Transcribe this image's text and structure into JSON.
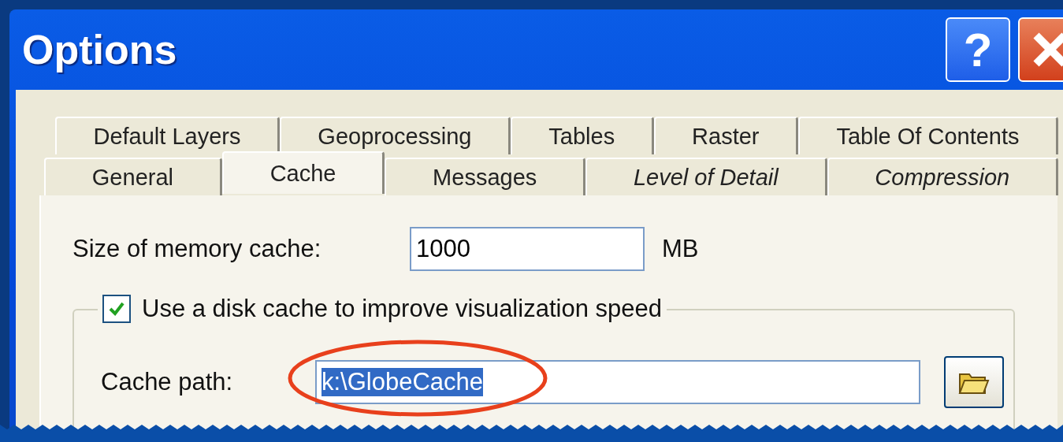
{
  "window": {
    "title": "Options",
    "buttons": [
      {
        "kind": "help",
        "label": "?"
      },
      {
        "kind": "close"
      }
    ]
  },
  "tab_rows": [
    {
      "tabs": [
        {
          "label": "Default Layers",
          "kind": "normal",
          "selected": false
        },
        {
          "label": "Geoprocessing",
          "kind": "normal",
          "selected": false
        },
        {
          "label": "Tables",
          "kind": "normal",
          "selected": false
        },
        {
          "label": "Raster",
          "kind": "normal",
          "selected": false
        },
        {
          "label": "Table Of Contents",
          "kind": "normal",
          "selected": false
        }
      ]
    },
    {
      "tabs": [
        {
          "label": "General",
          "kind": "normal",
          "selected": false
        },
        {
          "label": "Cache",
          "kind": "normal",
          "selected": true
        },
        {
          "label": "Messages",
          "kind": "normal",
          "selected": false
        },
        {
          "label": "Level of Detail",
          "kind": "italic",
          "selected": false
        },
        {
          "label": "Compression",
          "kind": "italic",
          "selected": false
        }
      ]
    }
  ],
  "memory_cache": {
    "label": "Size of memory cache:",
    "value": "1000",
    "unit": "MB"
  },
  "disk_cache": {
    "label": "Use a disk cache to improve visualization speed",
    "checked": true,
    "path": {
      "label": "Cache path:",
      "value": "k:\\GlobeCache",
      "value_selected": true,
      "highlighted": true
    }
  }
}
